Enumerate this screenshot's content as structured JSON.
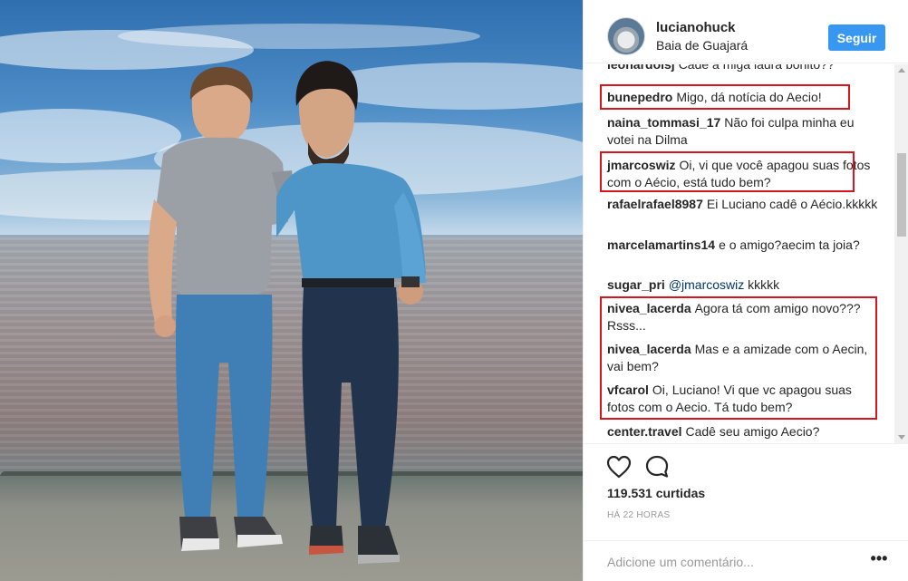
{
  "post": {
    "username": "lucianohuck",
    "location": "Baia de Guajará",
    "follow_label": "Seguir",
    "likes": "119.531 curtidas",
    "time": "HÁ 22 HORAS",
    "comment_placeholder": "Adicione um comentário...",
    "more_label": "•••"
  },
  "comments": [
    {
      "user": "leonardolsj",
      "text": "Cadê a miga laura bonito??"
    },
    {
      "user": "bunepedro",
      "text": "Migo, dá notícia do Aecio!"
    },
    {
      "user": "naina_tommasi_17",
      "text": "Não foi culpa minha eu votei na Dilma"
    },
    {
      "user": "jmarcoswiz",
      "text": "Oi, vi que você apagou suas fotos com o Aécio, está tudo bem?"
    },
    {
      "user": "rafaelrafael8987",
      "text": "Ei Luciano cadê o Aécio.kkkkk"
    },
    {
      "user": "marcelamartins14",
      "text": "e o amigo?aecim ta joia?"
    },
    {
      "user": "sugar_pri",
      "mention": "@jmarcoswiz",
      "text": "kkkkk"
    },
    {
      "user": "nivea_lacerda",
      "text": "Agora tá com amigo novo??? Rsss..."
    },
    {
      "user": "nivea_lacerda",
      "text": "Mas e a amizade com o Aecin, vai bem?"
    },
    {
      "user": "vfcarol",
      "text": "Oi, Luciano! Vi que vc apagou suas fotos com o Aecio. Tá tudo bem?"
    },
    {
      "user": "center.travel",
      "text": "Cadê seu amigo Aecio?"
    }
  ],
  "colors": {
    "highlight": "#d8141c",
    "follow_button": "#3897f0",
    "mention": "#003569"
  },
  "icons": {
    "like": "heart-icon",
    "comment": "comment-bubble-icon"
  }
}
